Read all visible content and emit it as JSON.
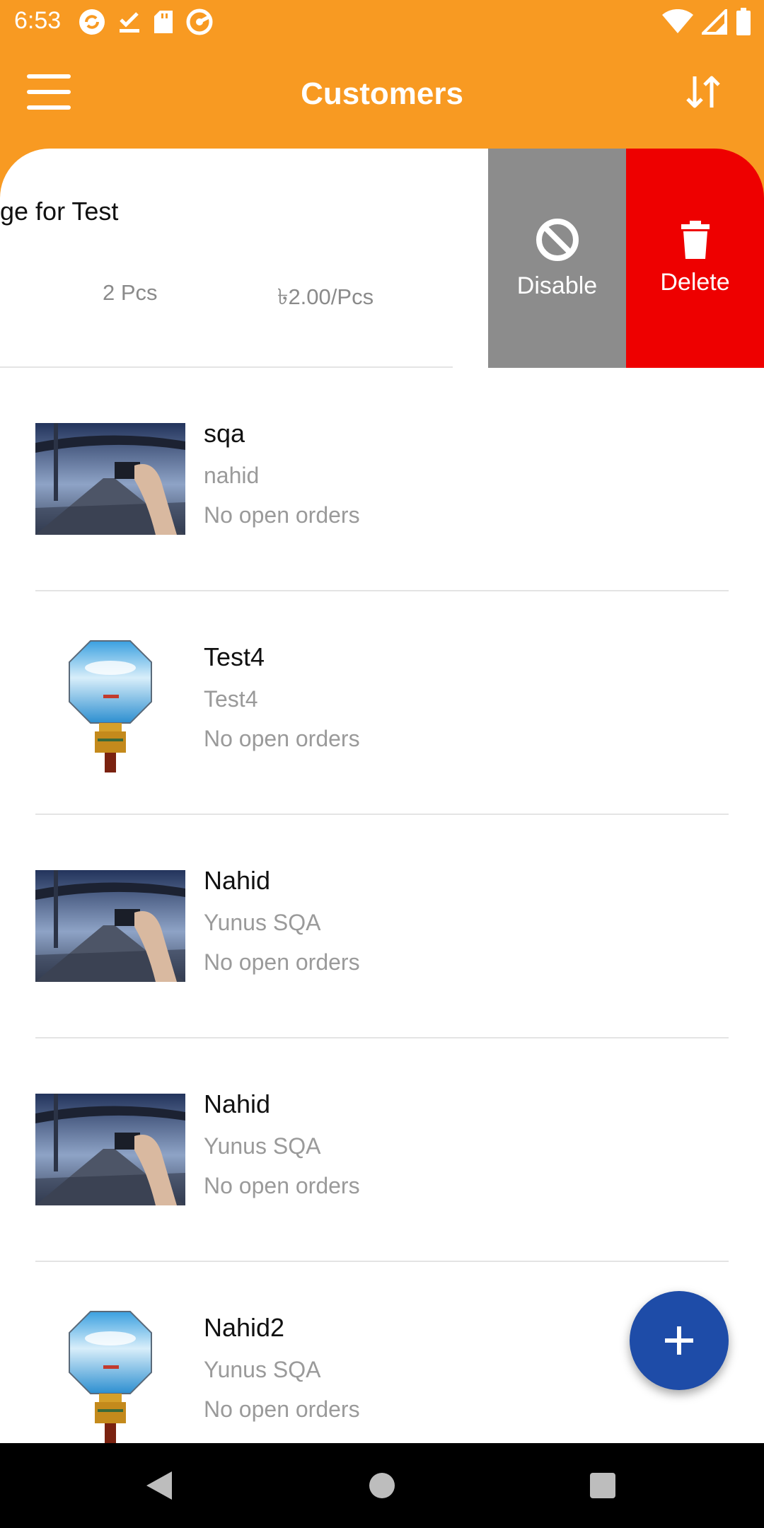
{
  "status_bar": {
    "time": "6:53",
    "left_icons": [
      "sync-icon",
      "check-download-icon",
      "sd-card-icon",
      "at-sign-icon"
    ],
    "right_icons": [
      "wifi-icon",
      "signal-icon",
      "battery-icon"
    ]
  },
  "app_bar": {
    "title": "Customers",
    "menu_icon": "hamburger-menu-icon",
    "sort_icon": "sort-arrows-icon",
    "color": "#F89A22"
  },
  "swiped_item": {
    "title_fragment": "ge for Test",
    "quantity": "2 Pcs",
    "price": "৳2.00/Pcs",
    "actions": [
      {
        "label": "Disable",
        "icon": "block-icon",
        "color": "#8C8C8C"
      },
      {
        "label": "Delete",
        "icon": "trash-icon",
        "color": "#EE0000"
      }
    ]
  },
  "customers": [
    {
      "name": "sqa",
      "company": "nahid",
      "orders": "No open orders",
      "thumb": "photo"
    },
    {
      "name": "Test4",
      "company": "Test4",
      "orders": "No open orders",
      "thumb": "lcd"
    },
    {
      "name": "Nahid",
      "company": "Yunus SQA",
      "orders": "No open orders",
      "thumb": "photo"
    },
    {
      "name": "Nahid",
      "company": "Yunus SQA",
      "orders": "No open orders",
      "thumb": "photo"
    },
    {
      "name": "Nahid2",
      "company": "Yunus SQA",
      "orders": "No open orders",
      "thumb": "lcd"
    }
  ],
  "fab": {
    "icon": "plus-icon",
    "color": "#1E4CA8"
  },
  "nav_bar": {
    "icons": [
      "back-icon",
      "home-icon",
      "recents-icon"
    ]
  }
}
